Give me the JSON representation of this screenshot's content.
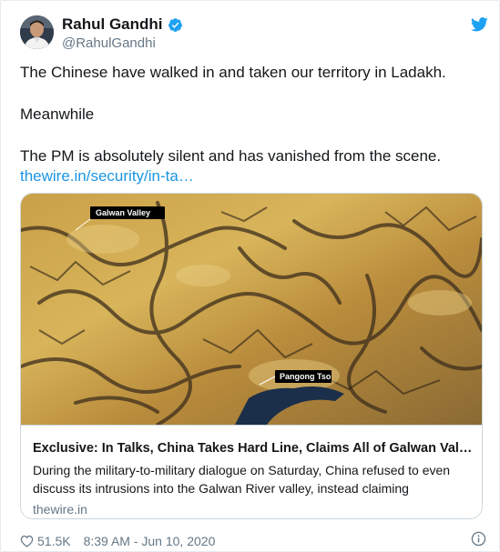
{
  "author": {
    "name": "Rahul Gandhi",
    "handle": "@RahulGandhi"
  },
  "tweet": {
    "line1": "The Chinese have walked in and taken our territory in Ladakh.",
    "line2": "Meanwhile",
    "line3": "The PM is absolutely silent and has vanished from the scene.",
    "link": "thewire.in/security/in-ta…"
  },
  "card": {
    "image_labels": {
      "galwan": "Galwan Valley",
      "pangong": "Pangong Tso"
    },
    "title": "Exclusive: In Talks, China Takes Hard Line, Claims All of Galwan Valle...",
    "description": "During the military-to-military dialogue on Saturday, China refused to even discuss its intrusions into the Galwan River valley, instead claiming",
    "domain": "thewire.in"
  },
  "footer": {
    "likes": "51.5K",
    "timestamp": "8:39 AM - Jun 10, 2020"
  },
  "colors": {
    "text": "#14171a",
    "secondary": "#657786",
    "link": "#1b95e0",
    "verified": "#1da1f2",
    "border": "#ccd6dd"
  },
  "icons": {
    "verified": "verified-badge-icon",
    "twitter": "twitter-bird-icon",
    "like": "heart-icon",
    "info": "info-icon"
  }
}
